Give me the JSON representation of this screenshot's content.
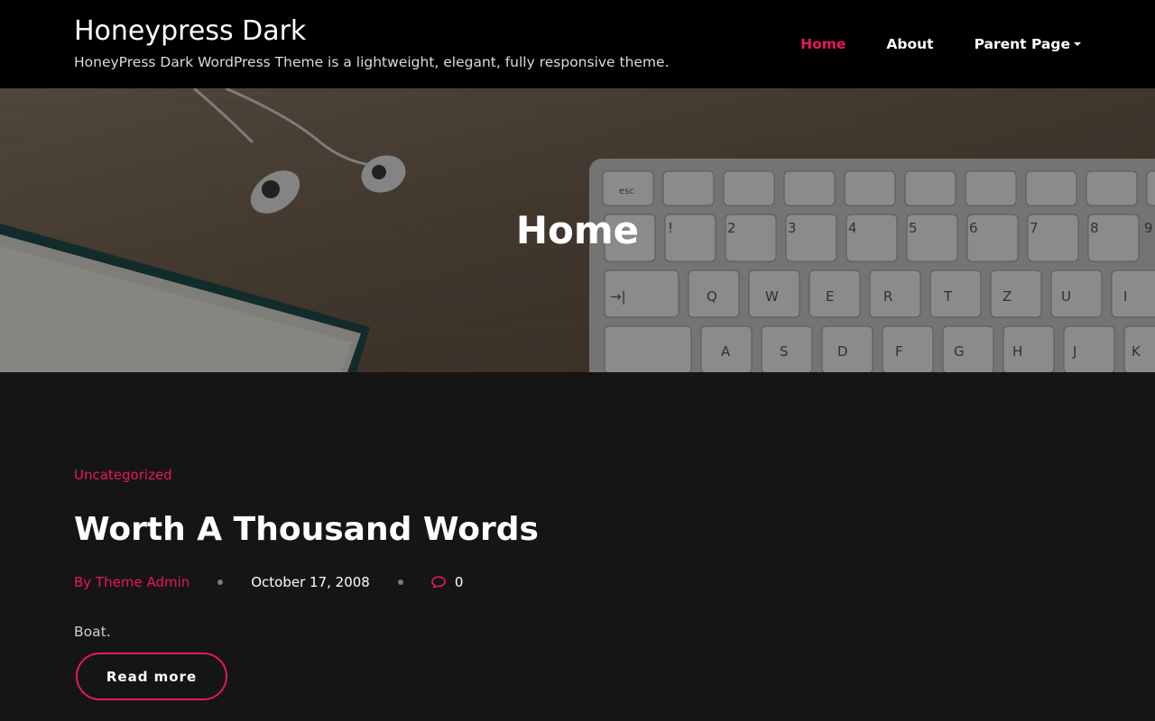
{
  "site": {
    "title": "Honeypress Dark",
    "tagline": "HoneyPress Dark WordPress Theme is a lightweight, elegant, fully responsive theme."
  },
  "nav": {
    "items": [
      {
        "label": "Home",
        "active": true
      },
      {
        "label": "About",
        "active": false
      },
      {
        "label": "Parent Page",
        "has_dropdown": true,
        "active": false
      }
    ]
  },
  "hero": {
    "title": "Home",
    "keyboard_keys": {
      "row1": [
        "esc",
        "",
        "",
        "",
        "",
        "",
        "",
        "",
        "",
        ""
      ],
      "row2": [
        "!",
        "2",
        "3",
        "4",
        "5",
        "6",
        "7",
        "8",
        "9"
      ],
      "row3": [
        "→|",
        "Q",
        "W",
        "E",
        "R",
        "T",
        "Z",
        "U",
        "I"
      ],
      "row4": [
        "",
        "A",
        "S",
        "D",
        "F",
        "G",
        "H",
        "J",
        "K"
      ]
    }
  },
  "post": {
    "category": "Uncategorized",
    "title": "Worth A Thousand Words",
    "author": "By Theme Admin",
    "date": "October 17, 2008",
    "comments": "0",
    "excerpt": "Boat.",
    "read_more": "Read more"
  },
  "colors": {
    "accent": "#e8175d",
    "header_bg": "#000000",
    "page_bg": "#151515"
  },
  "icons": {
    "comments": "comment-icon",
    "dropdown": "caret-down-icon"
  }
}
